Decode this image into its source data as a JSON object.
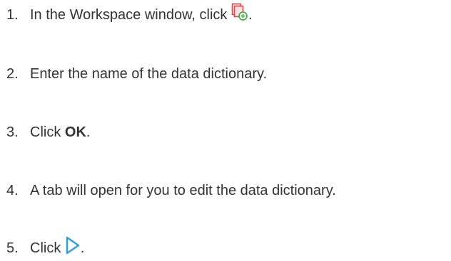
{
  "steps": [
    {
      "number": "1.",
      "text_before": "In the Workspace window, click ",
      "icon": "new-data-dictionary-icon",
      "text_after": "."
    },
    {
      "number": "2.",
      "text": "Enter the name of the data dictionary."
    },
    {
      "number": "3.",
      "text_before": "Click ",
      "bold": "OK",
      "text_after": "."
    },
    {
      "number": "4.",
      "text": "A tab will open for you to edit the data dictionary."
    },
    {
      "number": "5.",
      "text_before": "Click ",
      "icon": "play-outline-icon",
      "text_after": "."
    }
  ],
  "colors": {
    "text": "#333333",
    "icon_red": "#e0464a",
    "icon_green": "#3aa83a",
    "icon_blue": "#2f9ee0"
  }
}
